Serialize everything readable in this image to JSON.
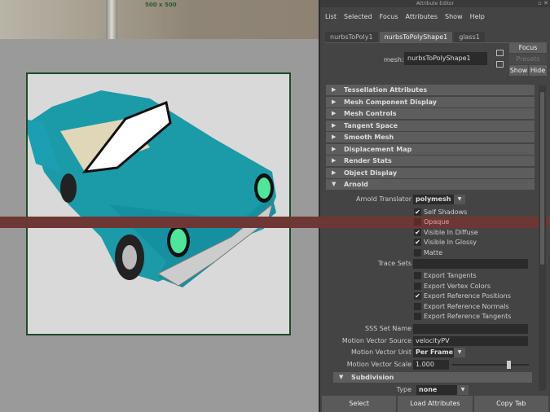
{
  "viewport": {
    "resolution": "500 x 500"
  },
  "attribute_editor": {
    "title": "Attribute Editor",
    "menu": [
      "List",
      "Selected",
      "Focus",
      "Attributes",
      "Show",
      "Help"
    ],
    "tabs": [
      {
        "label": "nurbsToPoly1"
      },
      {
        "label": "nurbsToPolyShape1",
        "active": true
      },
      {
        "label": "glass1"
      }
    ],
    "mesh_label": "mesh:",
    "mesh_value": "nurbsToPolyShape1",
    "focus": "Focus",
    "presets": "Presets",
    "show": "Show",
    "hide": "Hide",
    "sections": [
      "Tessellation Attributes",
      "Mesh Component Display",
      "Mesh Controls",
      "Tangent Space",
      "Smooth Mesh",
      "Displacement Map",
      "Render Stats",
      "Object Display",
      "Arnold"
    ],
    "arnold": {
      "translator_label": "Arnold Translator",
      "translator_value": "polymesh",
      "checks1": [
        {
          "label": "Self Shadows",
          "checked": true
        },
        {
          "label": "Opaque",
          "checked": false
        },
        {
          "label": "Visible In Diffuse",
          "checked": true
        },
        {
          "label": "Visible In Glossy",
          "checked": true
        },
        {
          "label": "Matte",
          "checked": false
        }
      ],
      "trace_sets_label": "Trace Sets",
      "checks2": [
        {
          "label": "Export Tangents",
          "checked": false
        },
        {
          "label": "Export Vertex Colors",
          "checked": false
        },
        {
          "label": "Export Reference Positions",
          "checked": true
        },
        {
          "label": "Export Reference Normals",
          "checked": false
        },
        {
          "label": "Export Reference Tangents",
          "checked": false
        }
      ],
      "sss_label": "SSS Set Name",
      "mv_source_label": "Motion Vector Source",
      "mv_source_value": "velocityPV",
      "mv_unit_label": "Motion Vector Unit",
      "mv_unit_value": "Per Frame",
      "mv_scale_label": "Motion Vector Scale",
      "mv_scale_value": "1.000",
      "mv_scale_slider": 0.75,
      "subdivision": "Subdivision",
      "type_label": "Type",
      "type_value": "none"
    },
    "buttons": {
      "select": "Select",
      "load": "Load Attributes",
      "copy": "Copy Tab"
    }
  },
  "colors": {
    "car": "#1b9aa8",
    "opaque_highlight": "#6e3734",
    "frame_border": "#1e4a2c"
  }
}
